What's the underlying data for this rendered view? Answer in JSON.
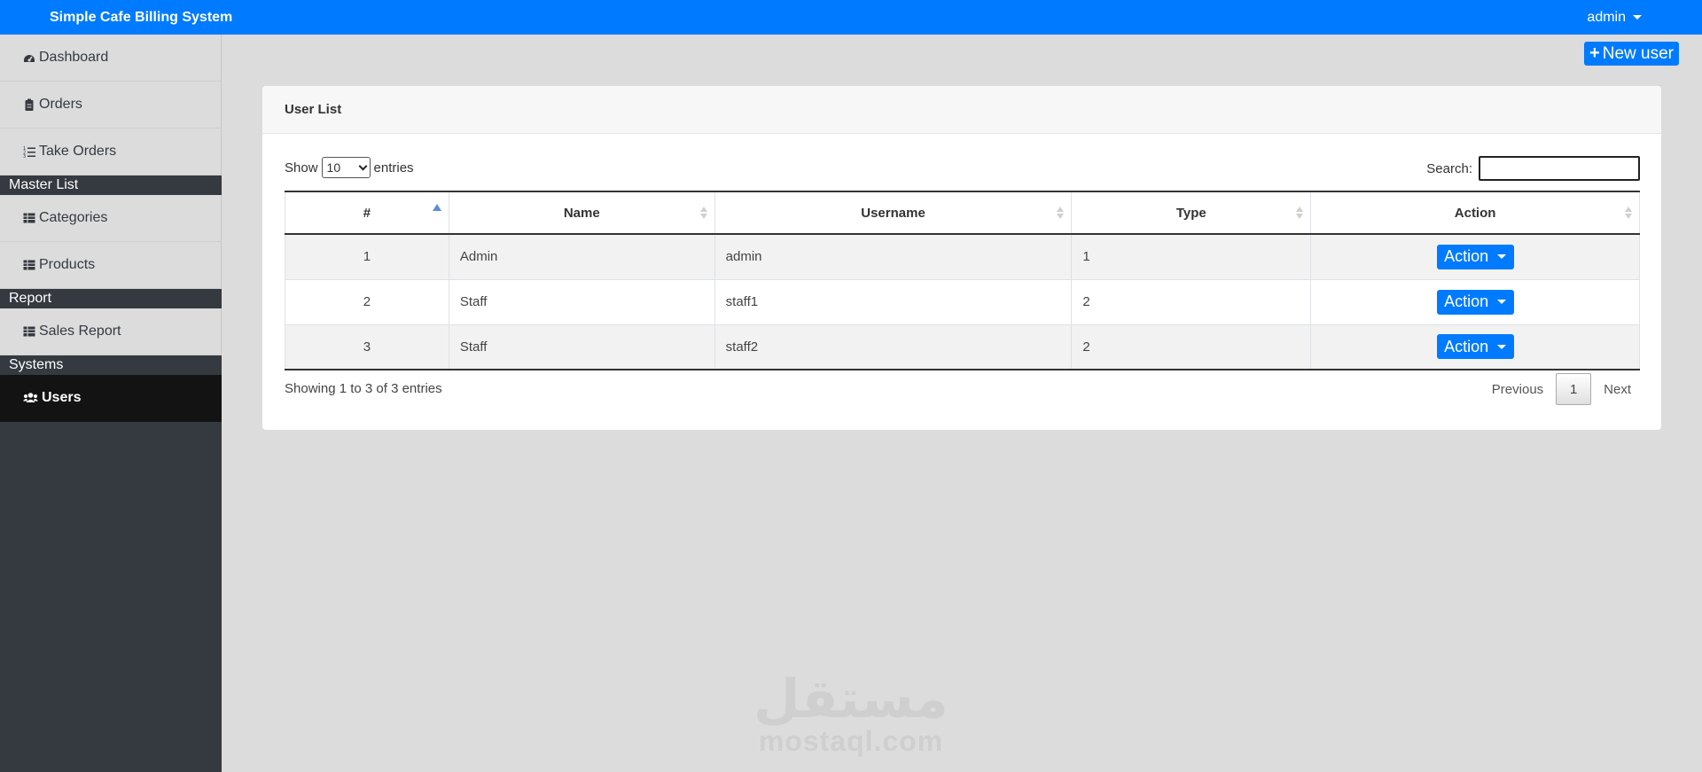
{
  "app": {
    "title": "Simple Cafe Billing System",
    "user_menu_label": "admin",
    "accent_color": "#007bff"
  },
  "sidebar": {
    "items": [
      {
        "label": "Dashboard",
        "icon": "dashboard-icon"
      },
      {
        "label": "Orders",
        "icon": "clipboard-icon"
      },
      {
        "label": "Take Orders",
        "icon": "list-ol-icon"
      }
    ],
    "sections": [
      {
        "title": "Master List",
        "items": [
          {
            "label": "Categories",
            "icon": "table-icon"
          },
          {
            "label": "Products",
            "icon": "table-icon"
          }
        ]
      },
      {
        "title": "Report",
        "items": [
          {
            "label": "Sales Report",
            "icon": "table-icon"
          }
        ]
      },
      {
        "title": "Systems",
        "items": [
          {
            "label": "Users",
            "icon": "users-icon",
            "active": true
          }
        ]
      }
    ]
  },
  "toolbar": {
    "new_user_label": "New user"
  },
  "card": {
    "title": "User List",
    "show_label": "Show",
    "entries_label": "entries",
    "page_length": "10",
    "search_label": "Search:",
    "search_value": ""
  },
  "table": {
    "columns": [
      "#",
      "Name",
      "Username",
      "Type",
      "Action"
    ],
    "rows": [
      {
        "num": "1",
        "name": "Admin",
        "username": "admin",
        "type": "1",
        "action": "Action"
      },
      {
        "num": "2",
        "name": "Staff",
        "username": "staff1",
        "type": "2",
        "action": "Action"
      },
      {
        "num": "3",
        "name": "Staff",
        "username": "staff2",
        "type": "2",
        "action": "Action"
      }
    ]
  },
  "footer": {
    "info": "Showing 1 to 3 of 3 entries",
    "previous_label": "Previous",
    "current_page": "1",
    "next_label": "Next"
  },
  "watermark": {
    "arabic": "مستقل",
    "latin": "mostaql.com"
  }
}
